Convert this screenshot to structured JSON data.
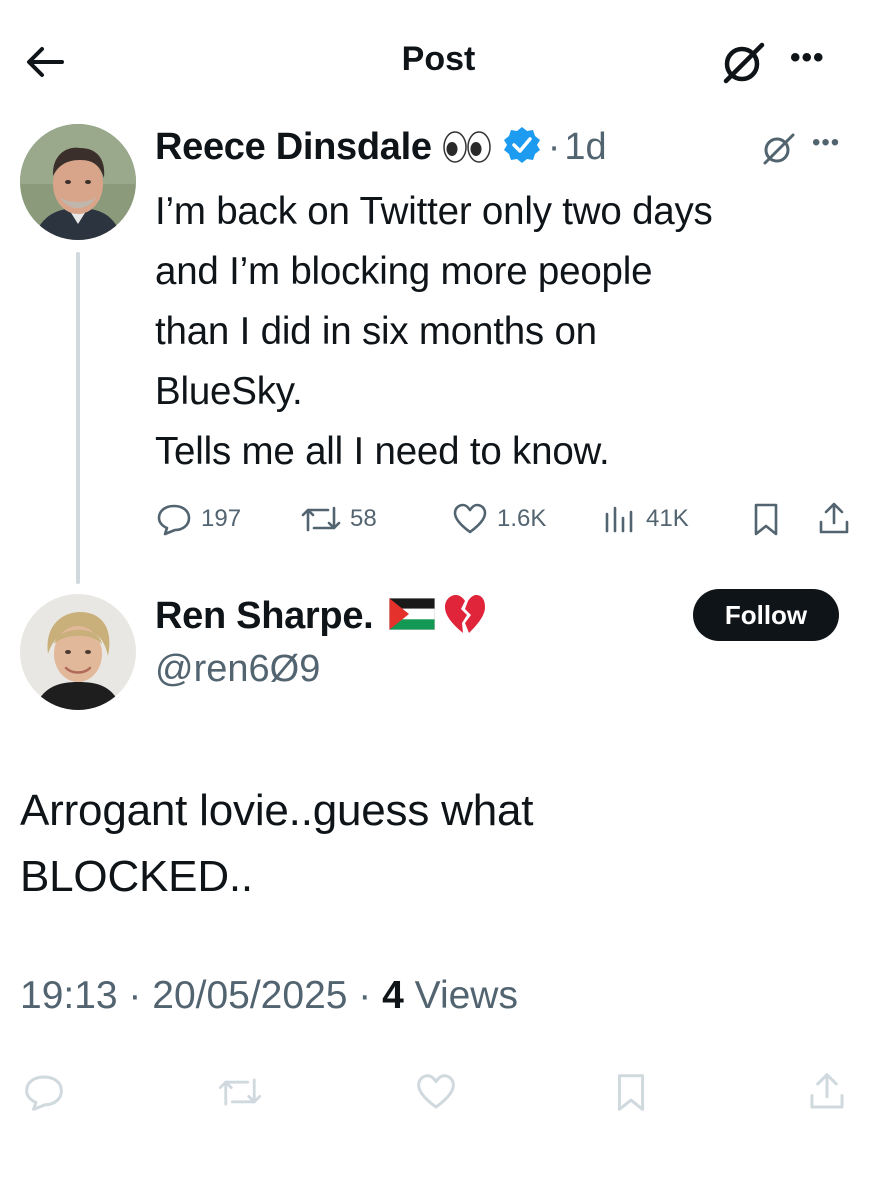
{
  "header": {
    "title": "Post",
    "more_label": "•••"
  },
  "original_tweet": {
    "author_name": "Reece Dinsdale",
    "separator": "·",
    "time": "1d",
    "text": "I’m back on Twitter only two days\nand I’m blocking more people\nthan I did in six months on\nBlueSky.\nTells me all I need to know.",
    "stats": {
      "replies": "197",
      "reposts": "58",
      "likes": "1.6K",
      "views": "41K"
    },
    "more_label": "•••",
    "verified_color": "#1d9bf0"
  },
  "reply_tweet": {
    "author_name": "Ren Sharpe.",
    "handle": "@ren6Ø9",
    "follow_label": "Follow",
    "text": "Arrogant lovie..guess what\nBLOCKED..",
    "timestamp": "19:13 · 20/05/2025 · ",
    "views_count": "4",
    "views_label": " Views"
  },
  "colors": {
    "text_primary": "#0f1419",
    "text_secondary": "#536471",
    "accent": "#1d9bf0",
    "icon_muted": "#cfd9de"
  },
  "icons": [
    "back-arrow-icon",
    "grok-icon",
    "more-icon",
    "eyes-emoji",
    "verified-badge-icon",
    "reply-icon",
    "repost-icon",
    "like-icon",
    "views-icon",
    "bookmark-icon",
    "share-icon",
    "palestine-flag-emoji",
    "broken-heart-emoji"
  ]
}
